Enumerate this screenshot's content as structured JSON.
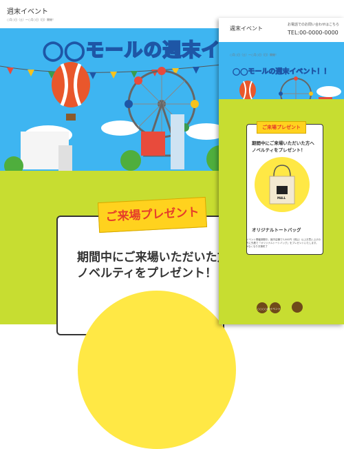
{
  "back_page": {
    "title": "週末イベント",
    "date": "○月○日（土）〜○月○日（日）開催！",
    "hero_title": "◯◯モールの週末イベント！！",
    "present_tag": "ご来場プレゼント",
    "message_line1": "期間中にご来場いただいた方へ",
    "message_line2": "ノベルティをプレゼント！"
  },
  "front_page": {
    "title": "週末イベント",
    "contact_label": "お電話でのお問い合わせはこちら",
    "tel": "TEL:00-0000-0000",
    "date": "○月○日（土）〜○月○日（日）開催！",
    "hero_title": "◯◯モールの週末イベント！！",
    "present_tag": "ご来場プレゼント",
    "message_line1": "期間中にご来場いただいた方へ",
    "message_line2": "ノベルティをプレゼント！",
    "bag_logo": "MALL",
    "bag_name": "オリジナルトートバッグ",
    "bag_description": "イベント開催期間中、館内店舗で3,000円（税込）以上お買い上げの方に先着で「オリジナルトートバッグ」をプレゼントいたします。",
    "bag_note": "※なくなり次第終了",
    "bottom_label": "○○○○のイベント"
  },
  "colors": {
    "sky": "#3eb5f1",
    "grass": "#c7dd31",
    "accent": "#ffd21e",
    "title_outline": "#1e56a6",
    "tag_text": "#e53d2a"
  },
  "icons": [
    "balloon-icon",
    "ferris-wheel-icon",
    "tote-bag-icon",
    "bunting-icon"
  ]
}
